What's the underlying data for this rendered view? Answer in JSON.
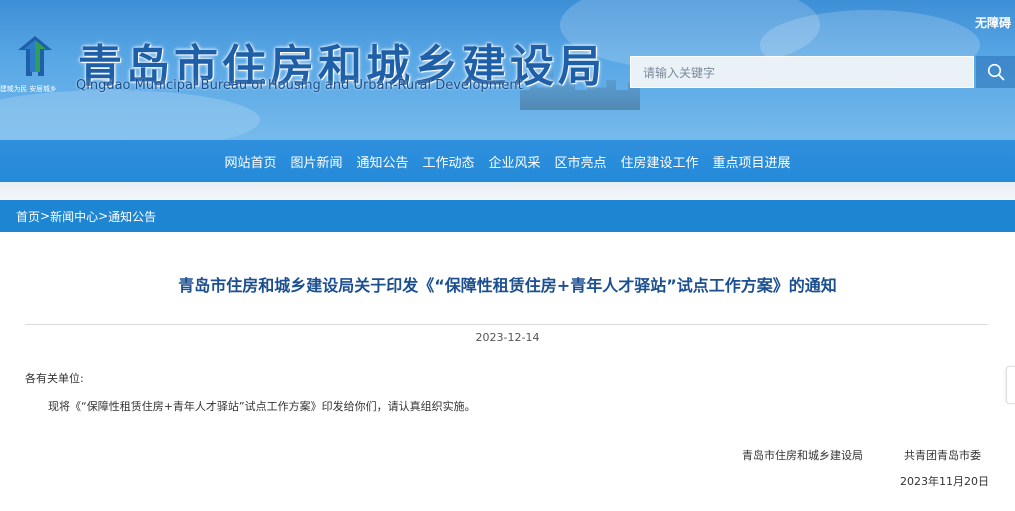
{
  "header": {
    "accessibility_label": "无障碍",
    "title": "青岛市住房和城乡建设局",
    "subtitle": "Qingdao Municipal Bureau of Housing and Urban-Rural Development",
    "logo_slogan": "建城为民 安居城乡",
    "search_placeholder": "请输入关键字",
    "search_icon": "search-icon"
  },
  "nav": {
    "items": [
      "网站首页",
      "图片新闻",
      "通知公告",
      "工作动态",
      "企业风采",
      "区市亮点",
      "住房建设工作",
      "重点项目进展"
    ]
  },
  "breadcrumb": {
    "home": "首页",
    "sep1": ">",
    "news": "新闻中心",
    "sep2": ">",
    "current": "通知公告"
  },
  "article": {
    "title": "青岛市住房和城乡建设局关于印发《“保障性租赁住房+青年人才驿站”试点工作方案》的通知",
    "date": "2023-12-14",
    "greeting": "各有关单位:",
    "body": "现将《“保障性租赁住房+青年人才驿站”试点工作方案》印发给你们，请认真组织实施。",
    "signer_1": "青岛市住房和城乡建设局",
    "signer_2": "共青团青岛市委",
    "signed_date": "2023年11月20日"
  },
  "colors": {
    "banner": "#3d8fd6",
    "nav": "#248ad8",
    "breadcrumb_bar": "#1e85d3",
    "title_text": "#1b4f8f"
  }
}
